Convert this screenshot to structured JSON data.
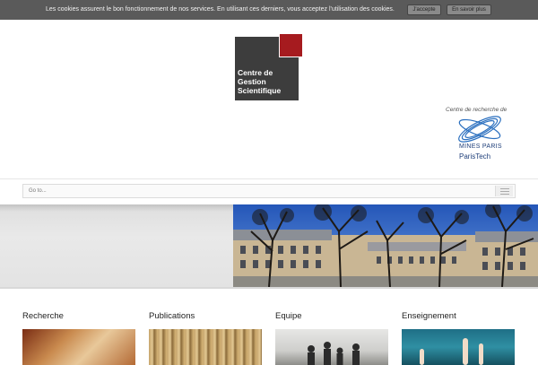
{
  "cookie_bar": {
    "text": "Les cookies assurent le bon fonctionnement de nos services. En utilisant ces derniers, vous acceptez l'utilisation des cookies.",
    "accept_label": "J'accepte",
    "more_label": "En savoir plus"
  },
  "header": {
    "logo_text": "Centre de Gestion Scientifique",
    "partner_label": "Centre de recherche de",
    "partner_name_line1": "MINES PARIS",
    "partner_name_line2": "ParisTech"
  },
  "nav": {
    "placeholder": "Go to..."
  },
  "sections": [
    {
      "title": "Recherche",
      "image": "book-text-photo"
    },
    {
      "title": "Publications",
      "image": "bookshelf-photo"
    },
    {
      "title": "Equipe",
      "image": "people-silhouettes-photo"
    },
    {
      "title": "Enseignement",
      "image": "raised-hands-photo"
    }
  ],
  "colors": {
    "brand_red": "#a61b1f",
    "brand_dark": "#3d3d3d",
    "cookie_bar_bg": "#5a5a5a",
    "partner_blue": "#1f3f7a"
  }
}
